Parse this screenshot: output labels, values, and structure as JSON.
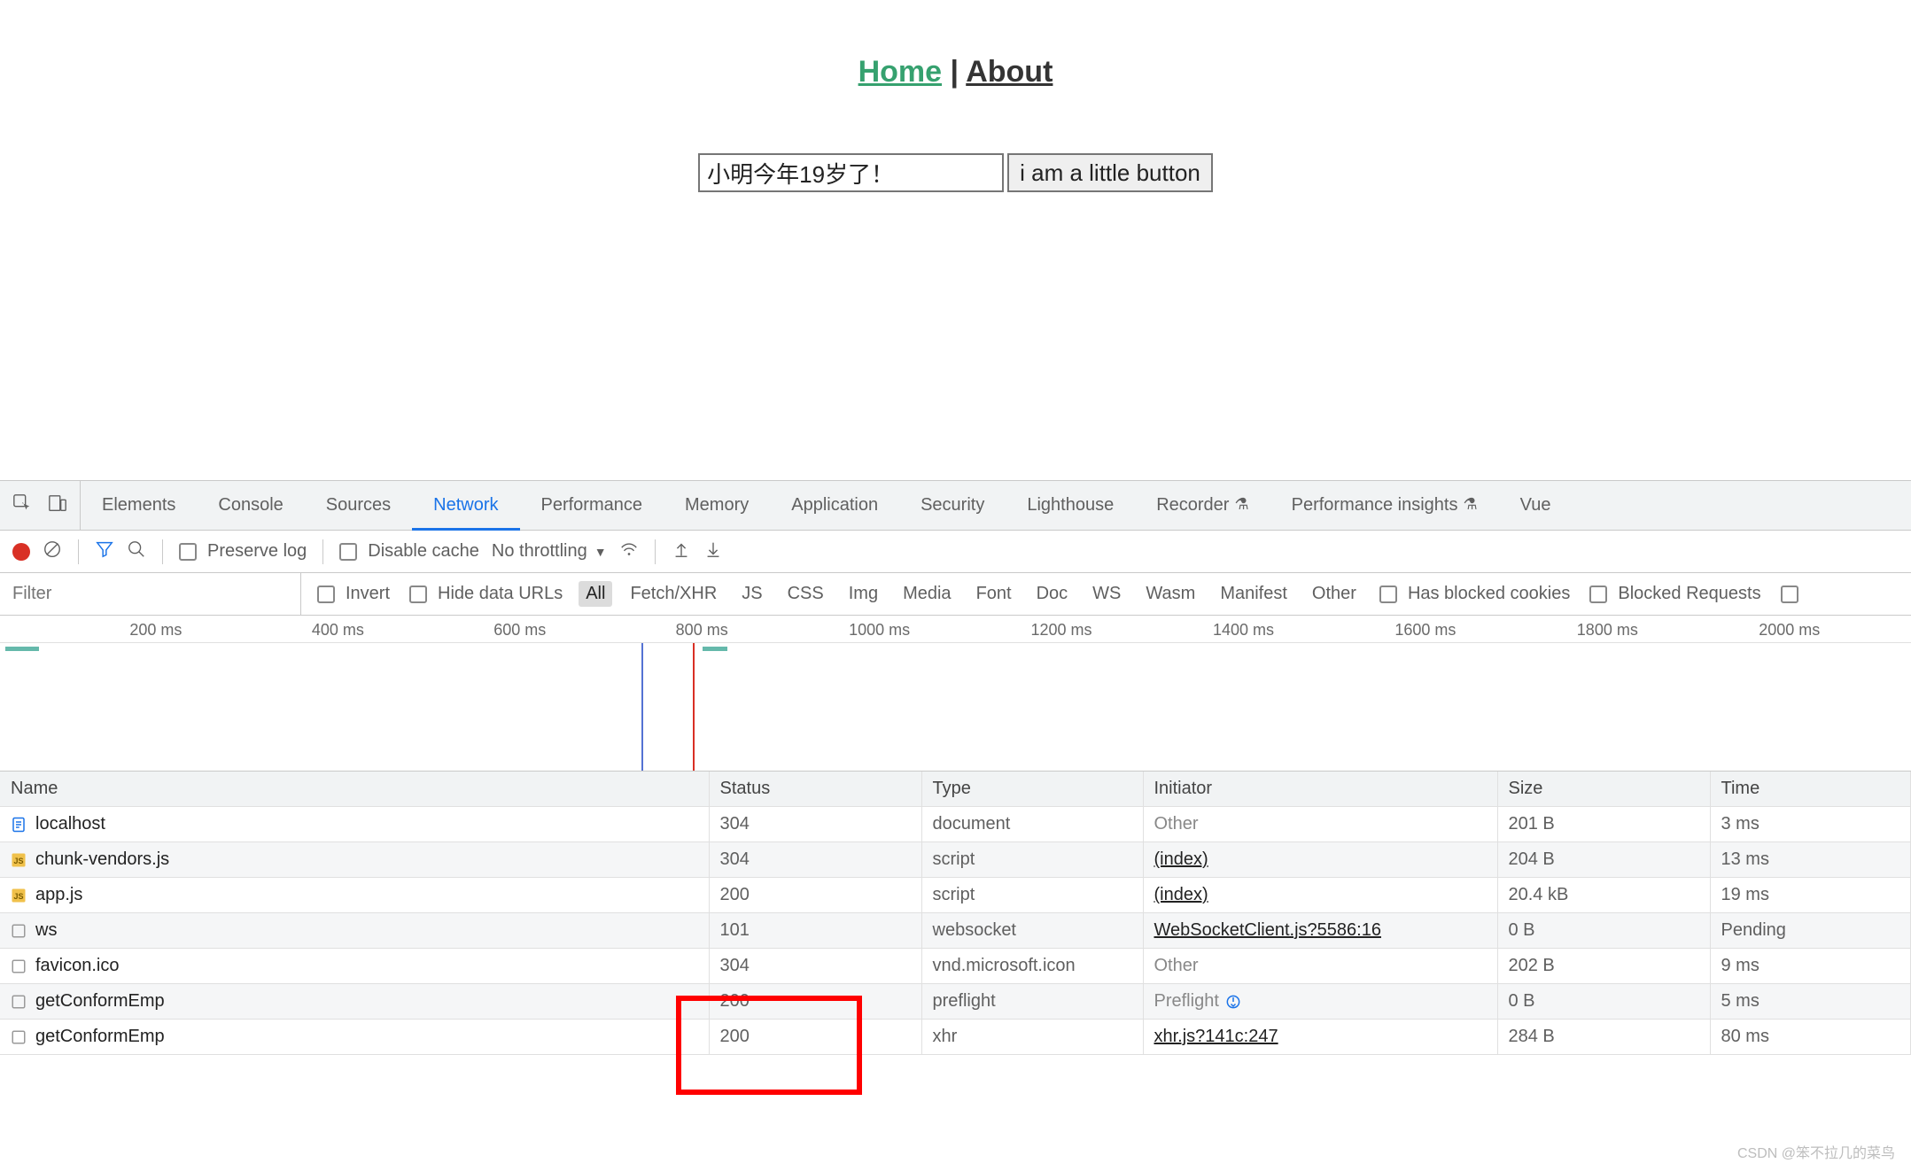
{
  "app": {
    "nav": {
      "home": "Home",
      "separator": " | ",
      "about": "About"
    },
    "input_value": "小明今年19岁了！",
    "button_label": "i am a little button"
  },
  "devtools": {
    "tabs": [
      "Elements",
      "Console",
      "Sources",
      "Network",
      "Performance",
      "Memory",
      "Application",
      "Security",
      "Lighthouse",
      "Recorder",
      "Performance insights",
      "Vue"
    ],
    "active_tab": "Network",
    "flask_tabs": [
      "Recorder",
      "Performance insights"
    ],
    "toolbar": {
      "preserve_log": "Preserve log",
      "disable_cache": "Disable cache",
      "throttling": "No throttling"
    },
    "filter": {
      "placeholder": "Filter",
      "invert": "Invert",
      "hide_data_urls": "Hide data URLs",
      "types": [
        "All",
        "Fetch/XHR",
        "JS",
        "CSS",
        "Img",
        "Media",
        "Font",
        "Doc",
        "WS",
        "Wasm",
        "Manifest",
        "Other"
      ],
      "active_type": "All",
      "has_blocked_cookies": "Has blocked cookies",
      "blocked_requests": "Blocked Requests"
    },
    "waterfall": {
      "ticks": [
        "200 ms",
        "400 ms",
        "600 ms",
        "800 ms",
        "1000 ms",
        "1200 ms",
        "1400 ms",
        "1600 ms",
        "1800 ms",
        "2000 ms"
      ]
    },
    "table": {
      "headers": {
        "name": "Name",
        "status": "Status",
        "type": "Type",
        "initiator": "Initiator",
        "size": "Size",
        "time": "Time"
      },
      "rows": [
        {
          "icon": "doc",
          "name": "localhost",
          "status": "304",
          "type": "document",
          "initiator": "Other",
          "initiator_link": false,
          "size": "201 B",
          "time": "3 ms"
        },
        {
          "icon": "js",
          "name": "chunk-vendors.js",
          "status": "304",
          "type": "script",
          "initiator": "(index)",
          "initiator_link": true,
          "size": "204 B",
          "time": "13 ms"
        },
        {
          "icon": "js",
          "name": "app.js",
          "status": "200",
          "type": "script",
          "initiator": "(index)",
          "initiator_link": true,
          "size": "20.4 kB",
          "time": "19 ms"
        },
        {
          "icon": "blank",
          "name": "ws",
          "status": "101",
          "type": "websocket",
          "initiator": "WebSocketClient.js?5586:16",
          "initiator_link": true,
          "size": "0 B",
          "time": "Pending"
        },
        {
          "icon": "blank",
          "name": "favicon.ico",
          "status": "304",
          "type": "vnd.microsoft.icon",
          "initiator": "Other",
          "initiator_link": false,
          "size": "202 B",
          "time": "9 ms"
        },
        {
          "icon": "blank",
          "name": "getConformEmp",
          "status": "200",
          "type": "preflight",
          "initiator": "Preflight",
          "initiator_link": false,
          "preflight_badge": true,
          "size": "0 B",
          "time": "5 ms"
        },
        {
          "icon": "blank",
          "name": "getConformEmp",
          "status": "200",
          "type": "xhr",
          "initiator": "xhr.js?141c:247",
          "initiator_link": true,
          "size": "284 B",
          "time": "80 ms"
        }
      ]
    }
  },
  "watermark": "CSDN @笨不拉几的菜鸟"
}
